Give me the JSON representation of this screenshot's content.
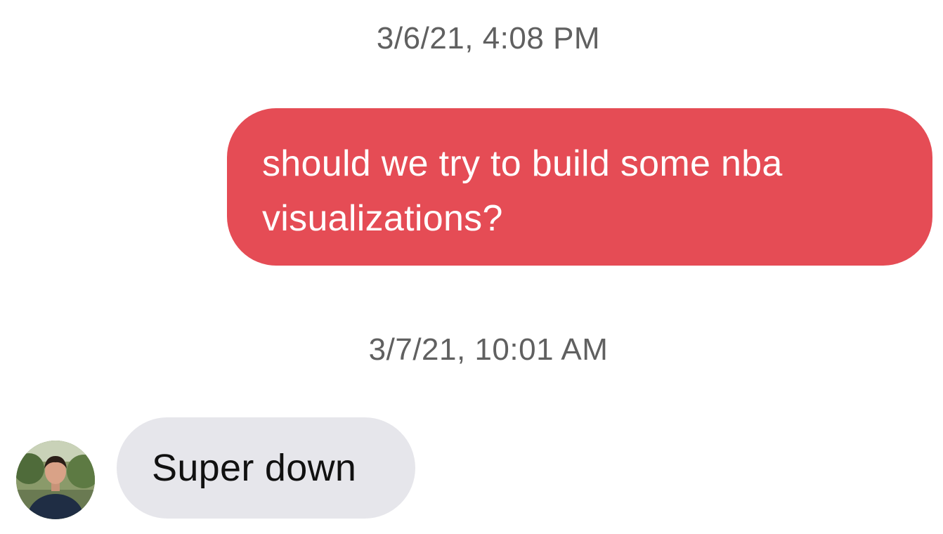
{
  "messages": [
    {
      "timestamp": "3/6/21, 4:08 PM",
      "direction": "outgoing",
      "text": "should we try to build some nba visualizations?",
      "bubble_color": "#e54c55"
    },
    {
      "timestamp": "3/7/21, 10:01 AM",
      "direction": "incoming",
      "text": "Super down",
      "bubble_color": "#e6e6eb",
      "avatar": "contact-avatar-photo"
    }
  ],
  "colors": {
    "timestamp": "#606060",
    "outgoing_text": "#ffffff",
    "incoming_text": "#111111"
  }
}
